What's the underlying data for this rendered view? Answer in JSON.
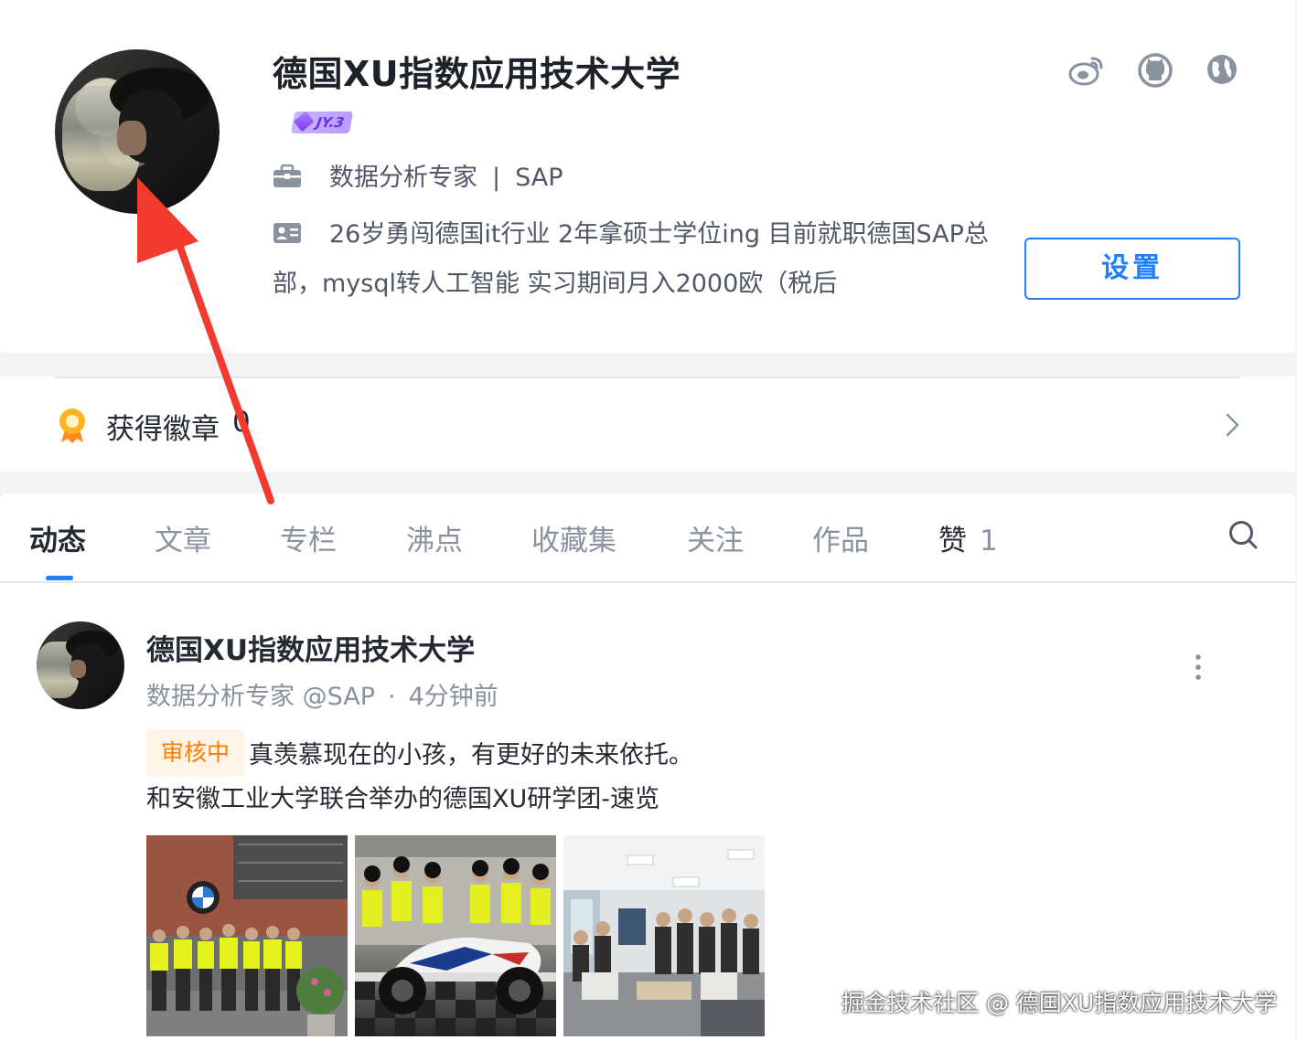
{
  "profile": {
    "username": "德国XU指数应用技术大学",
    "level_badge": "JY.3",
    "job_title": "数据分析专家",
    "job_separator": "|",
    "company": "SAP",
    "bio_line1": "26岁勇闯德国it行业 2年拿硕士学位ing 目前就职德国SAP总",
    "bio_line2": "部，mysql转人工智能 实习期间月入2000欧（税后",
    "settings_label": "设置",
    "social_icons": [
      "weibo-icon",
      "github-icon",
      "website-icon"
    ]
  },
  "badges": {
    "label": "获得徽章",
    "count": "0"
  },
  "tabs": [
    {
      "label": "动态",
      "active": true
    },
    {
      "label": "文章"
    },
    {
      "label": "专栏"
    },
    {
      "label": "沸点"
    },
    {
      "label": "收藏集"
    },
    {
      "label": "关注"
    },
    {
      "label": "作品"
    },
    {
      "label": "赞",
      "count": "1"
    }
  ],
  "post": {
    "author": "德国XU指数应用技术大学",
    "author_title": "数据分析专家 @SAP",
    "dot": "·",
    "time": "4分钟前",
    "status": "审核中",
    "line1": "真羡慕现在的小孩，有更好的未来依托。",
    "line2": "和安徽工业大学联合举办的德国XU研学团-速览",
    "image_count": 3
  },
  "watermark": "掘金技术社区 @ 德国XU指数应用技术大学",
  "colors": {
    "accent": "#1e80ff",
    "status_orange": "#ff7d00",
    "arrow_red": "#f33a2f",
    "level_purple": "#6b30e6"
  }
}
